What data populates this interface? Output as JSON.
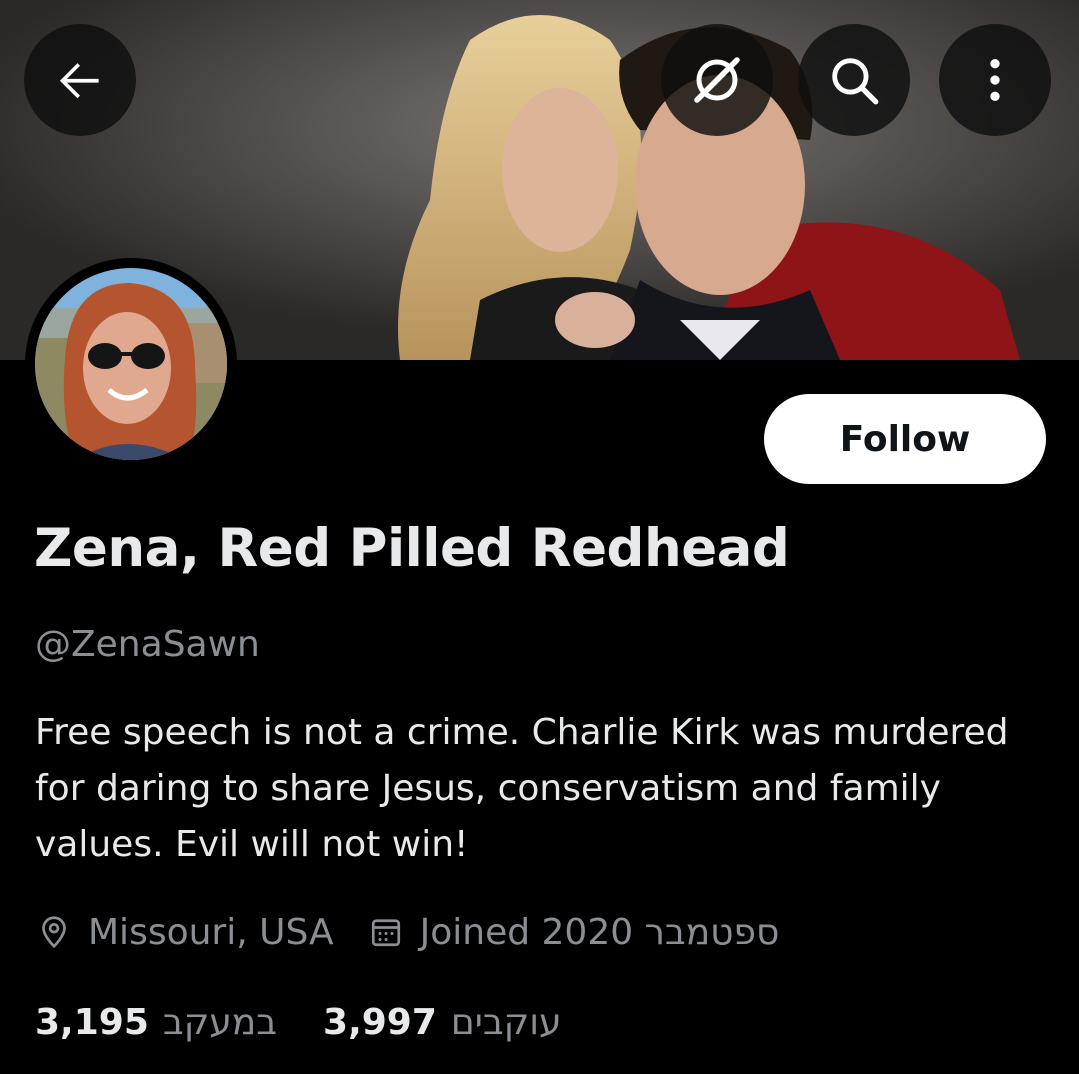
{
  "header": {
    "back_icon": "arrow-left-icon",
    "grok_icon": "grok-icon",
    "search_icon": "search-icon",
    "more_icon": "more-vertical-icon"
  },
  "profile": {
    "display_name": "Zena, Red Pilled Redhead",
    "handle": "@ZenaSawn",
    "bio": "Free speech is not a crime. Charlie Kirk was murdered for daring to share Jesus, conservatism and family values. Evil will not win!",
    "location": "Missouri, USA",
    "joined": "Joined 2020 ספטמבר",
    "following_count": "3,195",
    "following_label": "במעקב",
    "followers_count": "3,997",
    "followers_label": "עוקבים"
  },
  "actions": {
    "follow_label": "Follow"
  },
  "colors": {
    "background": "#000000",
    "primary_text": "#e7e9ea",
    "secondary_text": "#8b8f94",
    "follow_button_bg": "#ffffff",
    "follow_button_text": "#0f1419"
  }
}
